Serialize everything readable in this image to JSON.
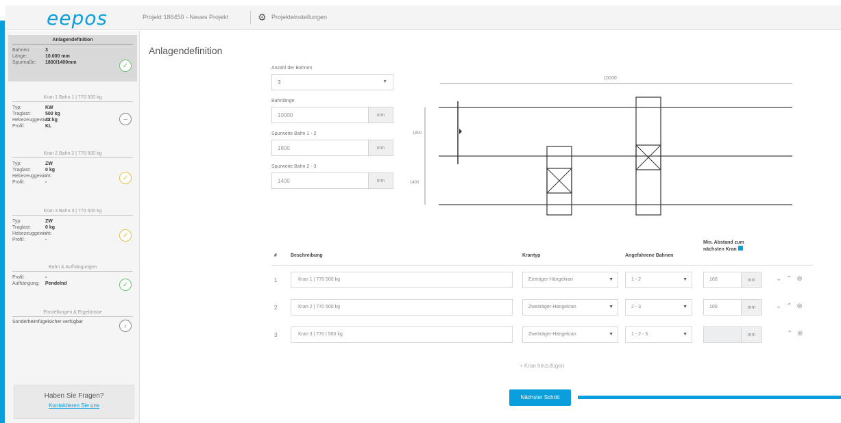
{
  "header": {
    "logo": "eepos",
    "breadcrumb": "Projekt 186450 - Neues Projekt",
    "settings_label": "Projekteinstellungen"
  },
  "sidebar": {
    "cards": [
      {
        "title": "Anlagendefinition",
        "rows": [
          {
            "k": "Bahnen:",
            "v": "3"
          },
          {
            "k": "Länge:",
            "v": "10.000 mm"
          },
          {
            "k": "Spurmaße:",
            "v": "1800/1400mm"
          }
        ],
        "status": "ok"
      },
      {
        "title": "Kran 1 Bahn 1 | 770 500 kg",
        "rows": [
          {
            "k": "Typ:",
            "v": "KW"
          },
          {
            "k": "Traglast:",
            "v": "500 kg"
          },
          {
            "k": "Hebezeuggewicht:",
            "v": "42 kg"
          },
          {
            "k": "Profil:",
            "v": "KL"
          }
        ],
        "status": "neutral"
      },
      {
        "title": "Kran 2 Bahn 2 | 770 500 kg",
        "rows": [
          {
            "k": "Typ:",
            "v": "ZW"
          },
          {
            "k": "Traglast:",
            "v": "0 kg"
          },
          {
            "k": "Hebezeuggewicht:",
            "v": "-"
          },
          {
            "k": "Profil:",
            "v": "-"
          }
        ],
        "status": "warn"
      },
      {
        "title": "Kran 3 Bahn 3 | 770 500 kg",
        "rows": [
          {
            "k": "Typ:",
            "v": "ZW"
          },
          {
            "k": "Traglast:",
            "v": "0 kg"
          },
          {
            "k": "Hebezeuggewicht:",
            "v": "-"
          },
          {
            "k": "Profil:",
            "v": "-"
          }
        ],
        "status": "warn"
      },
      {
        "title": "Bahn & Aufhängungen",
        "rows": [
          {
            "k": "Profil:",
            "v": "-"
          },
          {
            "k": "Aufhängung:",
            "v": "Pendelnd"
          }
        ],
        "status": "ok"
      },
      {
        "title": "Einstellungen & Ergebnisse",
        "single": "Sonderheimfügelsicher verfügbar",
        "status": "neutral"
      }
    ],
    "help": {
      "title": "Haben Sie Fragen?",
      "link": "Kontaktieren Sie uns"
    }
  },
  "main": {
    "title": "Anlagendefinition",
    "form": {
      "tracks_label": "Anzahl der Bahnen",
      "tracks_value": "3",
      "length_label": "Bahnlänge",
      "length_value": "10000",
      "gauge12_label": "Spurweite Bahn 1 - 2",
      "gauge12_value": "1800",
      "gauge23_label": "Spurweite Bahn 2 - 3",
      "gauge23_value": "1400",
      "unit": "mm"
    },
    "drawing": {
      "total_length": "10000",
      "gauge12": "1800",
      "gauge23": "1400"
    },
    "table": {
      "headers": {
        "num": "#",
        "desc": "Beschreibung",
        "type": "Krantyp",
        "tracks": "Angefahrene Bahnen",
        "dist": "Min. Abstand zum nächsten Kran"
      },
      "rows": [
        {
          "num": "1",
          "desc": "Kran 1 | 770 500 kg",
          "type": "Einträger-Hängekran",
          "tracks": "1 - 2",
          "dist": "100",
          "unit": "mm",
          "actions": "⌄ ⌃ ⊗",
          "disabled": false
        },
        {
          "num": "2",
          "desc": "Kran 2 | 770 500 kg",
          "type": "Zweiträger-Hängekran",
          "tracks": "2 - 3",
          "dist": "100",
          "unit": "mm",
          "actions": "⌄ ⌃ ⊗",
          "disabled": false
        },
        {
          "num": "3",
          "desc": "Kran 3 | 770 | 500 kg",
          "type": "Zweiträger-Hängekran",
          "tracks": "1 - 2 - 3",
          "dist": "",
          "unit": "mm",
          "actions": "⌃ ⊗",
          "disabled": true
        }
      ]
    },
    "add_label": "+ Kran hinzufügen",
    "next_label": "Nächster Schritt"
  }
}
